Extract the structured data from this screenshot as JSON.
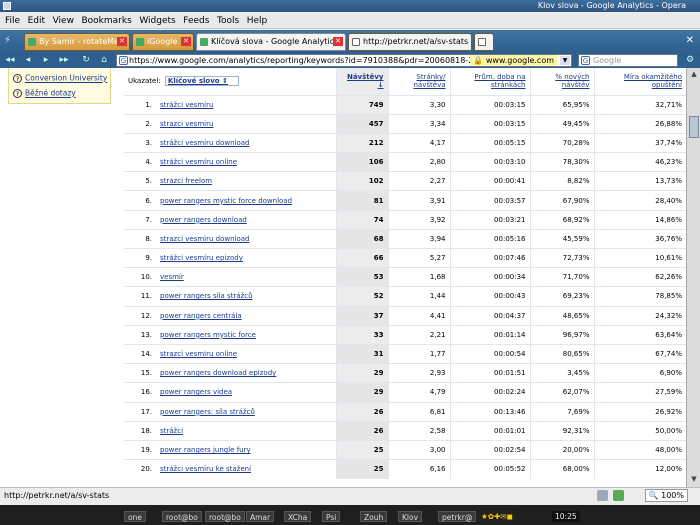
{
  "window": {
    "title": "Klov slova - Google Analytics - Opera"
  },
  "menu": [
    "File",
    "Edit",
    "View",
    "Bookmarks",
    "Widgets",
    "Feeds",
    "Tools",
    "Help"
  ],
  "tabs": [
    {
      "label": "By Samir - rotateMe",
      "style": "orange"
    },
    {
      "label": "iGoogle",
      "style": "orange"
    },
    {
      "label": "Klíčová slova - Google Analytics",
      "style": "active"
    },
    {
      "label": "http://petrkr.net/a/sv-stats",
      "style": "white"
    },
    {
      "label": "",
      "style": "white"
    }
  ],
  "address": {
    "url": "https://www.google.com/analytics/reporting/keywords?id=7910388&pdr=20060818-2008091",
    "domain": "www.google.com"
  },
  "search": {
    "placeholder": "Google"
  },
  "sidebar": {
    "links": [
      "Conversion University",
      "Běžné dotazy"
    ]
  },
  "table": {
    "selector_label": "Ukazatel:",
    "selector_value": "Klíčové slovo",
    "headers": [
      "Návštěvy ↓",
      "Stránky/ návštěva",
      "Prům. doba na stránkách",
      "% nových návštěv",
      "Míra okamžitého opuštění"
    ],
    "rows": [
      {
        "n": "1.",
        "kw": "strážci vesmíru",
        "v": "749",
        "p": "3,30",
        "t": "00:03:15",
        "nw": "65,95%",
        "b": "32,71%"
      },
      {
        "n": "2.",
        "kw": "strazci vesmiru",
        "v": "457",
        "p": "3,34",
        "t": "00:03:15",
        "nw": "49,45%",
        "b": "26,88%"
      },
      {
        "n": "3.",
        "kw": "strážci vesmíru download",
        "v": "212",
        "p": "4,17",
        "t": "00:05:15",
        "nw": "70,28%",
        "b": "37,74%"
      },
      {
        "n": "4.",
        "kw": "strážci vesmíru online",
        "v": "106",
        "p": "2,80",
        "t": "00:03:10",
        "nw": "78,30%",
        "b": "46,23%"
      },
      {
        "n": "5.",
        "kw": "strazci freelom",
        "v": "102",
        "p": "2,27",
        "t": "00:00:41",
        "nw": "8,82%",
        "b": "13,73%"
      },
      {
        "n": "6.",
        "kw": "power rangers mystic force download",
        "v": "81",
        "p": "3,91",
        "t": "00:03:57",
        "nw": "67,90%",
        "b": "28,40%"
      },
      {
        "n": "7.",
        "kw": "power rangers download",
        "v": "74",
        "p": "3,92",
        "t": "00:03:21",
        "nw": "68,92%",
        "b": "14,86%"
      },
      {
        "n": "8.",
        "kw": "strazci vesmiru download",
        "v": "68",
        "p": "3,94",
        "t": "00:05:16",
        "nw": "45,59%",
        "b": "36,76%"
      },
      {
        "n": "9.",
        "kw": "strážci vesmíru epizody",
        "v": "66",
        "p": "5,27",
        "t": "00:07:46",
        "nw": "72,73%",
        "b": "10,61%"
      },
      {
        "n": "10.",
        "kw": "vesmír",
        "v": "53",
        "p": "1,68",
        "t": "00:00:34",
        "nw": "71,70%",
        "b": "62,26%"
      },
      {
        "n": "11.",
        "kw": "power rangers síla strážců",
        "v": "52",
        "p": "1,44",
        "t": "00:00:43",
        "nw": "69,23%",
        "b": "78,85%"
      },
      {
        "n": "12.",
        "kw": "power rangers centrála",
        "v": "37",
        "p": "4,41",
        "t": "00:04:37",
        "nw": "48,65%",
        "b": "24,32%"
      },
      {
        "n": "13.",
        "kw": "power rangers mystic force",
        "v": "33",
        "p": "2,21",
        "t": "00:01:14",
        "nw": "96,97%",
        "b": "63,64%"
      },
      {
        "n": "14.",
        "kw": "strazci vesmiru online",
        "v": "31",
        "p": "1,77",
        "t": "00:00:54",
        "nw": "80,65%",
        "b": "67,74%"
      },
      {
        "n": "15.",
        "kw": "power rangers download epizody",
        "v": "29",
        "p": "2,93",
        "t": "00:01:51",
        "nw": "3,45%",
        "b": "6,90%"
      },
      {
        "n": "16.",
        "kw": "power rangers videa",
        "v": "29",
        "p": "4,79",
        "t": "00:02:24",
        "nw": "62,07%",
        "b": "27,59%"
      },
      {
        "n": "17.",
        "kw": "power rangers: síla strážců",
        "v": "26",
        "p": "6,81",
        "t": "00:13:46",
        "nw": "7,69%",
        "b": "26,92%"
      },
      {
        "n": "18.",
        "kw": "strážci",
        "v": "26",
        "p": "2,58",
        "t": "00:01:01",
        "nw": "92,31%",
        "b": "50,00%"
      },
      {
        "n": "19.",
        "kw": "power rangers jungle fury",
        "v": "25",
        "p": "3,00",
        "t": "00:02:54",
        "nw": "20,00%",
        "b": "48,00%"
      },
      {
        "n": "20.",
        "kw": "strážci vesmíru ke stažení",
        "v": "25",
        "p": "6,16",
        "t": "00:05:52",
        "nw": "68,00%",
        "b": "12,00%"
      }
    ]
  },
  "status": {
    "url": "http://petrkr.net/a/sv-stats",
    "zoom": "100%"
  },
  "taskbar": [
    "one",
    "root@bo",
    "root@bo",
    "Amar",
    "XCha",
    "Psi",
    "Zouh",
    "Klov",
    "petrkr@",
    "10:25"
  ]
}
